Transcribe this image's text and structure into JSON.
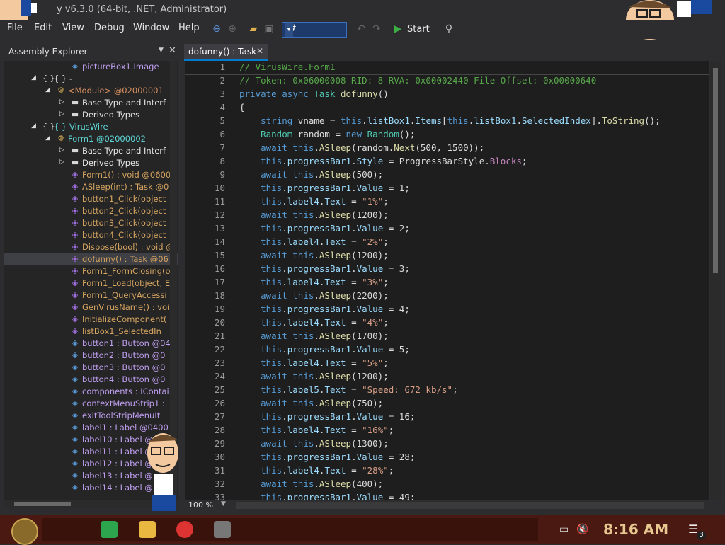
{
  "window": {
    "title": "y v6.3.0 (64-bit, .NET, Administrator)"
  },
  "menu": [
    "File",
    "Edit",
    "View",
    "Debug",
    "Window",
    "Help"
  ],
  "toolbar": {
    "language": "C#",
    "start_label": "Start"
  },
  "assembly_explorer": {
    "title": "Assembly Explorer",
    "items": [
      {
        "label": "pictureBox1.Image",
        "kind": "field",
        "indent": 3
      },
      {
        "label": "{ } -",
        "kind": "ns",
        "indent": 1
      },
      {
        "label": "<Module> @02000001",
        "kind": "type",
        "indent": 2
      },
      {
        "label": "Base Type and Interf",
        "kind": "folder",
        "indent": 3
      },
      {
        "label": "Derived Types",
        "kind": "folder",
        "indent": 3
      },
      {
        "label": "{ } VirusWire",
        "kind": "ns",
        "indent": 1
      },
      {
        "label": "Form1 @02000002",
        "kind": "type",
        "indent": 2
      },
      {
        "label": "Base Type and Interf",
        "kind": "folder",
        "indent": 3
      },
      {
        "label": "Derived Types",
        "kind": "folder",
        "indent": 3
      },
      {
        "label": "Form1() : void @0600",
        "kind": "method",
        "indent": 3
      },
      {
        "label": "ASleep(int) : Task @0",
        "kind": "method",
        "indent": 3
      },
      {
        "label": "button1_Click(object",
        "kind": "method",
        "indent": 3
      },
      {
        "label": "button2_Click(object",
        "kind": "method",
        "indent": 3
      },
      {
        "label": "button3_Click(object",
        "kind": "method",
        "indent": 3
      },
      {
        "label": "button4_Click(object",
        "kind": "method",
        "indent": 3
      },
      {
        "label": "Dispose(bool) : void @",
        "kind": "method",
        "indent": 3
      },
      {
        "label": "dofunny() : Task @06",
        "kind": "method",
        "indent": 3,
        "selected": true
      },
      {
        "label": "Form1_FormClosing(o",
        "kind": "method",
        "indent": 3
      },
      {
        "label": "Form1_Load(object, E",
        "kind": "method",
        "indent": 3
      },
      {
        "label": "Form1_QueryAccessi",
        "kind": "method",
        "indent": 3
      },
      {
        "label": "GenVirusName() : voi",
        "kind": "method",
        "indent": 3
      },
      {
        "label": "InitializeComponent(",
        "kind": "method",
        "indent": 3
      },
      {
        "label": "listBox1_SelectedIn",
        "kind": "method",
        "indent": 3
      },
      {
        "label": "button1 : Button @04",
        "kind": "field",
        "indent": 3
      },
      {
        "label": "button2 : Button @0",
        "kind": "field",
        "indent": 3
      },
      {
        "label": "button3 : Button @0",
        "kind": "field",
        "indent": 3
      },
      {
        "label": "button4 : Button @0",
        "kind": "field",
        "indent": 3
      },
      {
        "label": "components : IContai",
        "kind": "field",
        "indent": 3
      },
      {
        "label": "contextMenuStrip1 :",
        "kind": "field",
        "indent": 3
      },
      {
        "label": "exitToolStripMenuIt",
        "kind": "field",
        "indent": 3
      },
      {
        "label": "label1 : Label @0400",
        "kind": "field",
        "indent": 3
      },
      {
        "label": "label10 : Label @",
        "kind": "field",
        "indent": 3
      },
      {
        "label": "label11 : Label @",
        "kind": "field",
        "indent": 3
      },
      {
        "label": "label12 : Label @",
        "kind": "field",
        "indent": 3
      },
      {
        "label": "label13 : Label @",
        "kind": "field",
        "indent": 3
      },
      {
        "label": "label14 : Label @",
        "kind": "field",
        "indent": 3
      }
    ]
  },
  "editor": {
    "tab_label": "dofunny() : Task",
    "zoom": "100 %",
    "lines": [
      [
        {
          "t": "// VirusWire.Form1",
          "c": "cmt"
        }
      ],
      [
        {
          "t": "// Token: 0x06000008 RID: 8 RVA: 0x00002440 File Offset: 0x00000640",
          "c": "cmt"
        }
      ],
      [
        {
          "t": "private async ",
          "c": "kw"
        },
        {
          "t": "Task ",
          "c": "mem"
        },
        {
          "t": "dofunny",
          "c": "meth"
        },
        {
          "t": "()",
          "c": "id"
        }
      ],
      [
        {
          "t": "{",
          "c": "id"
        }
      ],
      [
        {
          "t": "    string ",
          "c": "kw"
        },
        {
          "t": "vname = ",
          "c": "id"
        },
        {
          "t": "this",
          "c": "kw"
        },
        {
          "t": ".",
          "c": "id"
        },
        {
          "t": "listBox1",
          "c": "prop"
        },
        {
          "t": ".",
          "c": "id"
        },
        {
          "t": "Items",
          "c": "prop"
        },
        {
          "t": "[",
          "c": "id"
        },
        {
          "t": "this",
          "c": "kw"
        },
        {
          "t": ".",
          "c": "id"
        },
        {
          "t": "listBox1",
          "c": "prop"
        },
        {
          "t": ".",
          "c": "id"
        },
        {
          "t": "SelectedIndex",
          "c": "prop"
        },
        {
          "t": "].",
          "c": "id"
        },
        {
          "t": "ToString",
          "c": "meth"
        },
        {
          "t": "();",
          "c": "id"
        }
      ],
      [
        {
          "t": "    Random ",
          "c": "mem"
        },
        {
          "t": "random = ",
          "c": "id"
        },
        {
          "t": "new ",
          "c": "kw"
        },
        {
          "t": "Random",
          "c": "mem"
        },
        {
          "t": "();",
          "c": "id"
        }
      ],
      [
        {
          "t": "    await this",
          "c": "kw"
        },
        {
          "t": ".",
          "c": "id"
        },
        {
          "t": "ASleep",
          "c": "meth"
        },
        {
          "t": "(random.",
          "c": "id"
        },
        {
          "t": "Next",
          "c": "meth"
        },
        {
          "t": "(500, 1500));",
          "c": "id"
        }
      ],
      [
        {
          "t": "    this",
          "c": "kw"
        },
        {
          "t": ".",
          "c": "id"
        },
        {
          "t": "progressBar1",
          "c": "prop"
        },
        {
          "t": ".",
          "c": "id"
        },
        {
          "t": "Style",
          "c": "prop"
        },
        {
          "t": " = ProgressBarStyle.",
          "c": "id"
        },
        {
          "t": "Blocks",
          "c": "mcolor"
        },
        {
          "t": ";",
          "c": "id"
        }
      ],
      [
        {
          "t": "    await this",
          "c": "kw"
        },
        {
          "t": ".",
          "c": "id"
        },
        {
          "t": "ASleep",
          "c": "meth"
        },
        {
          "t": "(500);",
          "c": "id"
        }
      ],
      [
        {
          "t": "    this",
          "c": "kw"
        },
        {
          "t": ".",
          "c": "id"
        },
        {
          "t": "progressBar1",
          "c": "prop"
        },
        {
          "t": ".",
          "c": "id"
        },
        {
          "t": "Value",
          "c": "prop"
        },
        {
          "t": " = 1;",
          "c": "id"
        }
      ],
      [
        {
          "t": "    this",
          "c": "kw"
        },
        {
          "t": ".",
          "c": "id"
        },
        {
          "t": "label4",
          "c": "prop"
        },
        {
          "t": ".",
          "c": "id"
        },
        {
          "t": "Text",
          "c": "prop"
        },
        {
          "t": " = ",
          "c": "id"
        },
        {
          "t": "\"1%\"",
          "c": "str"
        },
        {
          "t": ";",
          "c": "id"
        }
      ],
      [
        {
          "t": "    await this",
          "c": "kw"
        },
        {
          "t": ".",
          "c": "id"
        },
        {
          "t": "ASleep",
          "c": "meth"
        },
        {
          "t": "(1200);",
          "c": "id"
        }
      ],
      [
        {
          "t": "    this",
          "c": "kw"
        },
        {
          "t": ".",
          "c": "id"
        },
        {
          "t": "progressBar1",
          "c": "prop"
        },
        {
          "t": ".",
          "c": "id"
        },
        {
          "t": "Value",
          "c": "prop"
        },
        {
          "t": " = 2;",
          "c": "id"
        }
      ],
      [
        {
          "t": "    this",
          "c": "kw"
        },
        {
          "t": ".",
          "c": "id"
        },
        {
          "t": "label4",
          "c": "prop"
        },
        {
          "t": ".",
          "c": "id"
        },
        {
          "t": "Text",
          "c": "prop"
        },
        {
          "t": " = ",
          "c": "id"
        },
        {
          "t": "\"2%\"",
          "c": "str"
        },
        {
          "t": ";",
          "c": "id"
        }
      ],
      [
        {
          "t": "    await this",
          "c": "kw"
        },
        {
          "t": ".",
          "c": "id"
        },
        {
          "t": "ASleep",
          "c": "meth"
        },
        {
          "t": "(1200);",
          "c": "id"
        }
      ],
      [
        {
          "t": "    this",
          "c": "kw"
        },
        {
          "t": ".",
          "c": "id"
        },
        {
          "t": "progressBar1",
          "c": "prop"
        },
        {
          "t": ".",
          "c": "id"
        },
        {
          "t": "Value",
          "c": "prop"
        },
        {
          "t": " = 3;",
          "c": "id"
        }
      ],
      [
        {
          "t": "    this",
          "c": "kw"
        },
        {
          "t": ".",
          "c": "id"
        },
        {
          "t": "label4",
          "c": "prop"
        },
        {
          "t": ".",
          "c": "id"
        },
        {
          "t": "Text",
          "c": "prop"
        },
        {
          "t": " = ",
          "c": "id"
        },
        {
          "t": "\"3%\"",
          "c": "str"
        },
        {
          "t": ";",
          "c": "id"
        }
      ],
      [
        {
          "t": "    await this",
          "c": "kw"
        },
        {
          "t": ".",
          "c": "id"
        },
        {
          "t": "ASleep",
          "c": "meth"
        },
        {
          "t": "(2200);",
          "c": "id"
        }
      ],
      [
        {
          "t": "    this",
          "c": "kw"
        },
        {
          "t": ".",
          "c": "id"
        },
        {
          "t": "progressBar1",
          "c": "prop"
        },
        {
          "t": ".",
          "c": "id"
        },
        {
          "t": "Value",
          "c": "prop"
        },
        {
          "t": " = 4;",
          "c": "id"
        }
      ],
      [
        {
          "t": "    this",
          "c": "kw"
        },
        {
          "t": ".",
          "c": "id"
        },
        {
          "t": "label4",
          "c": "prop"
        },
        {
          "t": ".",
          "c": "id"
        },
        {
          "t": "Text",
          "c": "prop"
        },
        {
          "t": " = ",
          "c": "id"
        },
        {
          "t": "\"4%\"",
          "c": "str"
        },
        {
          "t": ";",
          "c": "id"
        }
      ],
      [
        {
          "t": "    await this",
          "c": "kw"
        },
        {
          "t": ".",
          "c": "id"
        },
        {
          "t": "ASleep",
          "c": "meth"
        },
        {
          "t": "(1700);",
          "c": "id"
        }
      ],
      [
        {
          "t": "    this",
          "c": "kw"
        },
        {
          "t": ".",
          "c": "id"
        },
        {
          "t": "progressBar1",
          "c": "prop"
        },
        {
          "t": ".",
          "c": "id"
        },
        {
          "t": "Value",
          "c": "prop"
        },
        {
          "t": " = 5;",
          "c": "id"
        }
      ],
      [
        {
          "t": "    this",
          "c": "kw"
        },
        {
          "t": ".",
          "c": "id"
        },
        {
          "t": "label4",
          "c": "prop"
        },
        {
          "t": ".",
          "c": "id"
        },
        {
          "t": "Text",
          "c": "prop"
        },
        {
          "t": " = ",
          "c": "id"
        },
        {
          "t": "\"5%\"",
          "c": "str"
        },
        {
          "t": ";",
          "c": "id"
        }
      ],
      [
        {
          "t": "    await this",
          "c": "kw"
        },
        {
          "t": ".",
          "c": "id"
        },
        {
          "t": "ASleep",
          "c": "meth"
        },
        {
          "t": "(1200);",
          "c": "id"
        }
      ],
      [
        {
          "t": "    this",
          "c": "kw"
        },
        {
          "t": ".",
          "c": "id"
        },
        {
          "t": "label5",
          "c": "prop"
        },
        {
          "t": ".",
          "c": "id"
        },
        {
          "t": "Text",
          "c": "prop"
        },
        {
          "t": " = ",
          "c": "id"
        },
        {
          "t": "\"Speed: 672 kb/s\"",
          "c": "str"
        },
        {
          "t": ";",
          "c": "id"
        }
      ],
      [
        {
          "t": "    await this",
          "c": "kw"
        },
        {
          "t": ".",
          "c": "id"
        },
        {
          "t": "ASleep",
          "c": "meth"
        },
        {
          "t": "(750);",
          "c": "id"
        }
      ],
      [
        {
          "t": "    this",
          "c": "kw"
        },
        {
          "t": ".",
          "c": "id"
        },
        {
          "t": "progressBar1",
          "c": "prop"
        },
        {
          "t": ".",
          "c": "id"
        },
        {
          "t": "Value",
          "c": "prop"
        },
        {
          "t": " = 16;",
          "c": "id"
        }
      ],
      [
        {
          "t": "    this",
          "c": "kw"
        },
        {
          "t": ".",
          "c": "id"
        },
        {
          "t": "label4",
          "c": "prop"
        },
        {
          "t": ".",
          "c": "id"
        },
        {
          "t": "Text",
          "c": "prop"
        },
        {
          "t": " = ",
          "c": "id"
        },
        {
          "t": "\"16%\"",
          "c": "str"
        },
        {
          "t": ";",
          "c": "id"
        }
      ],
      [
        {
          "t": "    await this",
          "c": "kw"
        },
        {
          "t": ".",
          "c": "id"
        },
        {
          "t": "ASleep",
          "c": "meth"
        },
        {
          "t": "(1300);",
          "c": "id"
        }
      ],
      [
        {
          "t": "    this",
          "c": "kw"
        },
        {
          "t": ".",
          "c": "id"
        },
        {
          "t": "progressBar1",
          "c": "prop"
        },
        {
          "t": ".",
          "c": "id"
        },
        {
          "t": "Value",
          "c": "prop"
        },
        {
          "t": " = 28;",
          "c": "id"
        }
      ],
      [
        {
          "t": "    this",
          "c": "kw"
        },
        {
          "t": ".",
          "c": "id"
        },
        {
          "t": "label4",
          "c": "prop"
        },
        {
          "t": ".",
          "c": "id"
        },
        {
          "t": "Text",
          "c": "prop"
        },
        {
          "t": " = ",
          "c": "id"
        },
        {
          "t": "\"28%\"",
          "c": "str"
        },
        {
          "t": ";",
          "c": "id"
        }
      ],
      [
        {
          "t": "    await this",
          "c": "kw"
        },
        {
          "t": ".",
          "c": "id"
        },
        {
          "t": "ASleep",
          "c": "meth"
        },
        {
          "t": "(400);",
          "c": "id"
        }
      ],
      [
        {
          "t": "    this",
          "c": "kw"
        },
        {
          "t": ".",
          "c": "id"
        },
        {
          "t": "progressBar1",
          "c": "prop"
        },
        {
          "t": ".",
          "c": "id"
        },
        {
          "t": "Value",
          "c": "prop"
        },
        {
          "t": " = 49;",
          "c": "id"
        }
      ]
    ]
  },
  "taskbar": {
    "clock": "8:16 AM",
    "notification_count": "3"
  }
}
